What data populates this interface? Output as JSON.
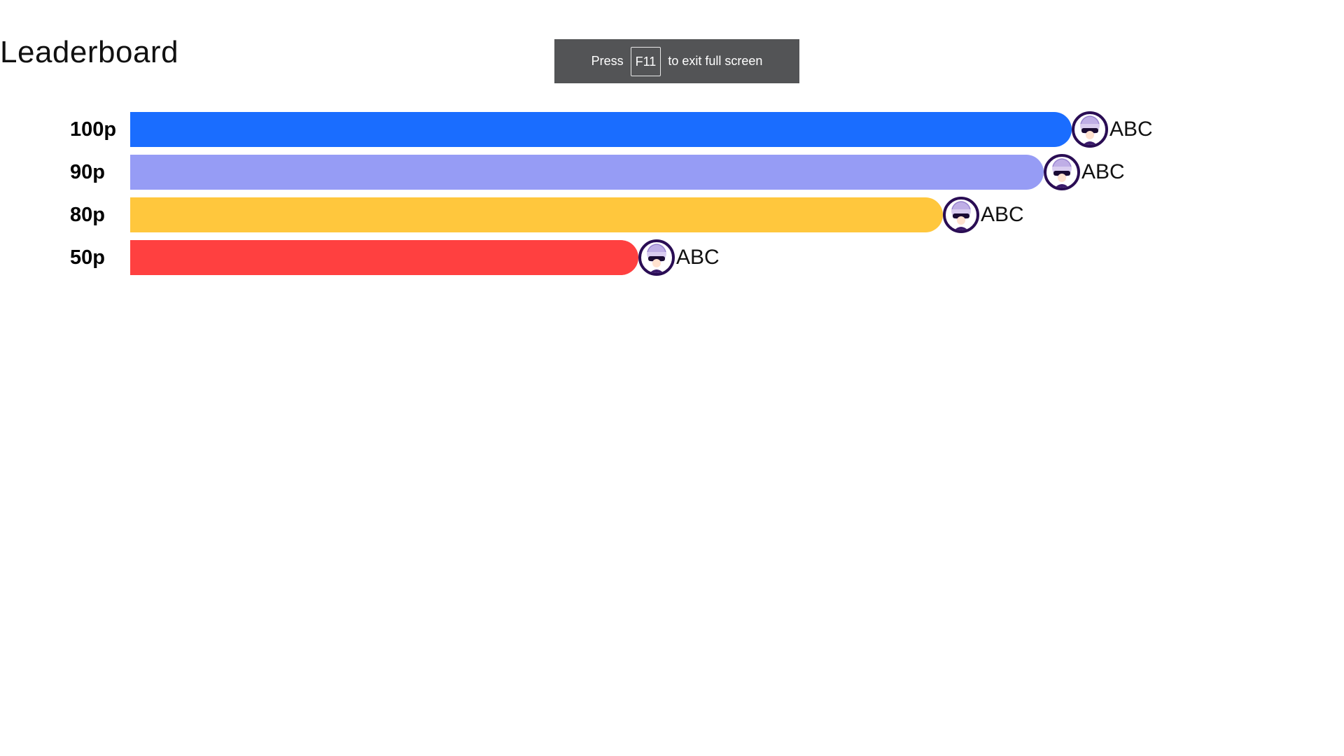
{
  "page": {
    "title": "Leaderboard"
  },
  "fullscreen_toast": {
    "press": "Press",
    "key": "F11",
    "rest": "to exit full screen"
  },
  "chart_data": {
    "type": "bar",
    "orientation": "horizontal",
    "max": 100,
    "rows": [
      {
        "score_label": "100p",
        "value": 100,
        "name": "ABC",
        "color": "#1A6DFF",
        "avatar": "avatar-icon"
      },
      {
        "score_label": "90p",
        "value": 97,
        "name": "ABC",
        "color": "#969CF5",
        "avatar": "avatar-icon"
      },
      {
        "score_label": "80p",
        "value": 86.3,
        "name": "ABC",
        "color": "#FFC73D",
        "avatar": "avatar-icon"
      },
      {
        "score_label": "50p",
        "value": 54,
        "name": "ABC",
        "color": "#FF4040",
        "avatar": "avatar-icon"
      }
    ]
  }
}
